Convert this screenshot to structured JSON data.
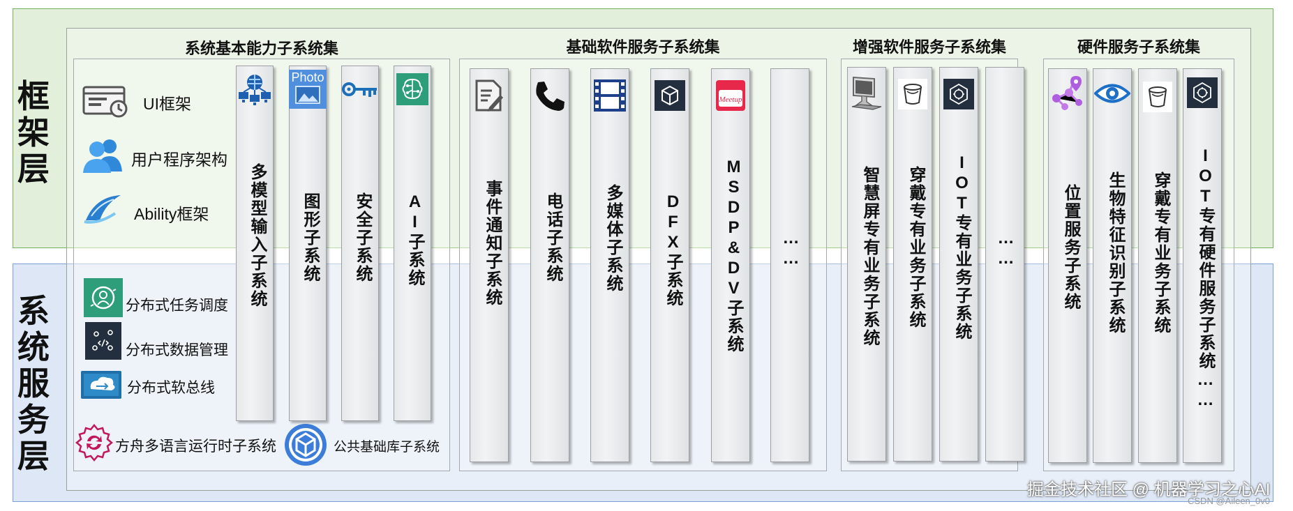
{
  "layers": {
    "framework": "框架层",
    "system_services": "系统服务层"
  },
  "groups": {
    "basic_capability": {
      "title": "系统基本能力子系统集",
      "frameworks": [
        "UI框架",
        "用户程序架构",
        "Ability框架"
      ],
      "distributed": [
        "分布式任务调度",
        "分布式数据管理",
        "分布式软总线"
      ],
      "ark_runtime": "方舟多语言运行时子系统",
      "common_lib": "公共基础库子系统",
      "photo_icon_text": "Photo",
      "columns": [
        "多模型输入子系统",
        "图形子系统",
        "安全子系统",
        "AI子系统"
      ]
    },
    "basic_software": {
      "title": "基础软件服务子系统集",
      "meetup_icon_text": "Meetup",
      "columns": [
        "事件通知子系统",
        "电话子系统",
        "多媒体子系统",
        "DFX子系统",
        "MSDP&DV子系统",
        "……"
      ]
    },
    "enhanced_software": {
      "title": "增强软件服务子系统集",
      "columns": [
        "智慧屏专有业务子系统",
        "穿戴专有业务子系统",
        "IOT专有业务子系统",
        "……"
      ]
    },
    "hardware": {
      "title": "硬件服务子系统集",
      "columns": [
        "位置服务子系统",
        "生物特征识别子系统",
        "穿戴专有业务子系统",
        "IOT专有硬件服务子系统……"
      ]
    }
  },
  "watermarks": {
    "main": "掘金技术社区 @ 机器学习之心AI",
    "csdn": "CSDN @Aileen_0v0"
  }
}
